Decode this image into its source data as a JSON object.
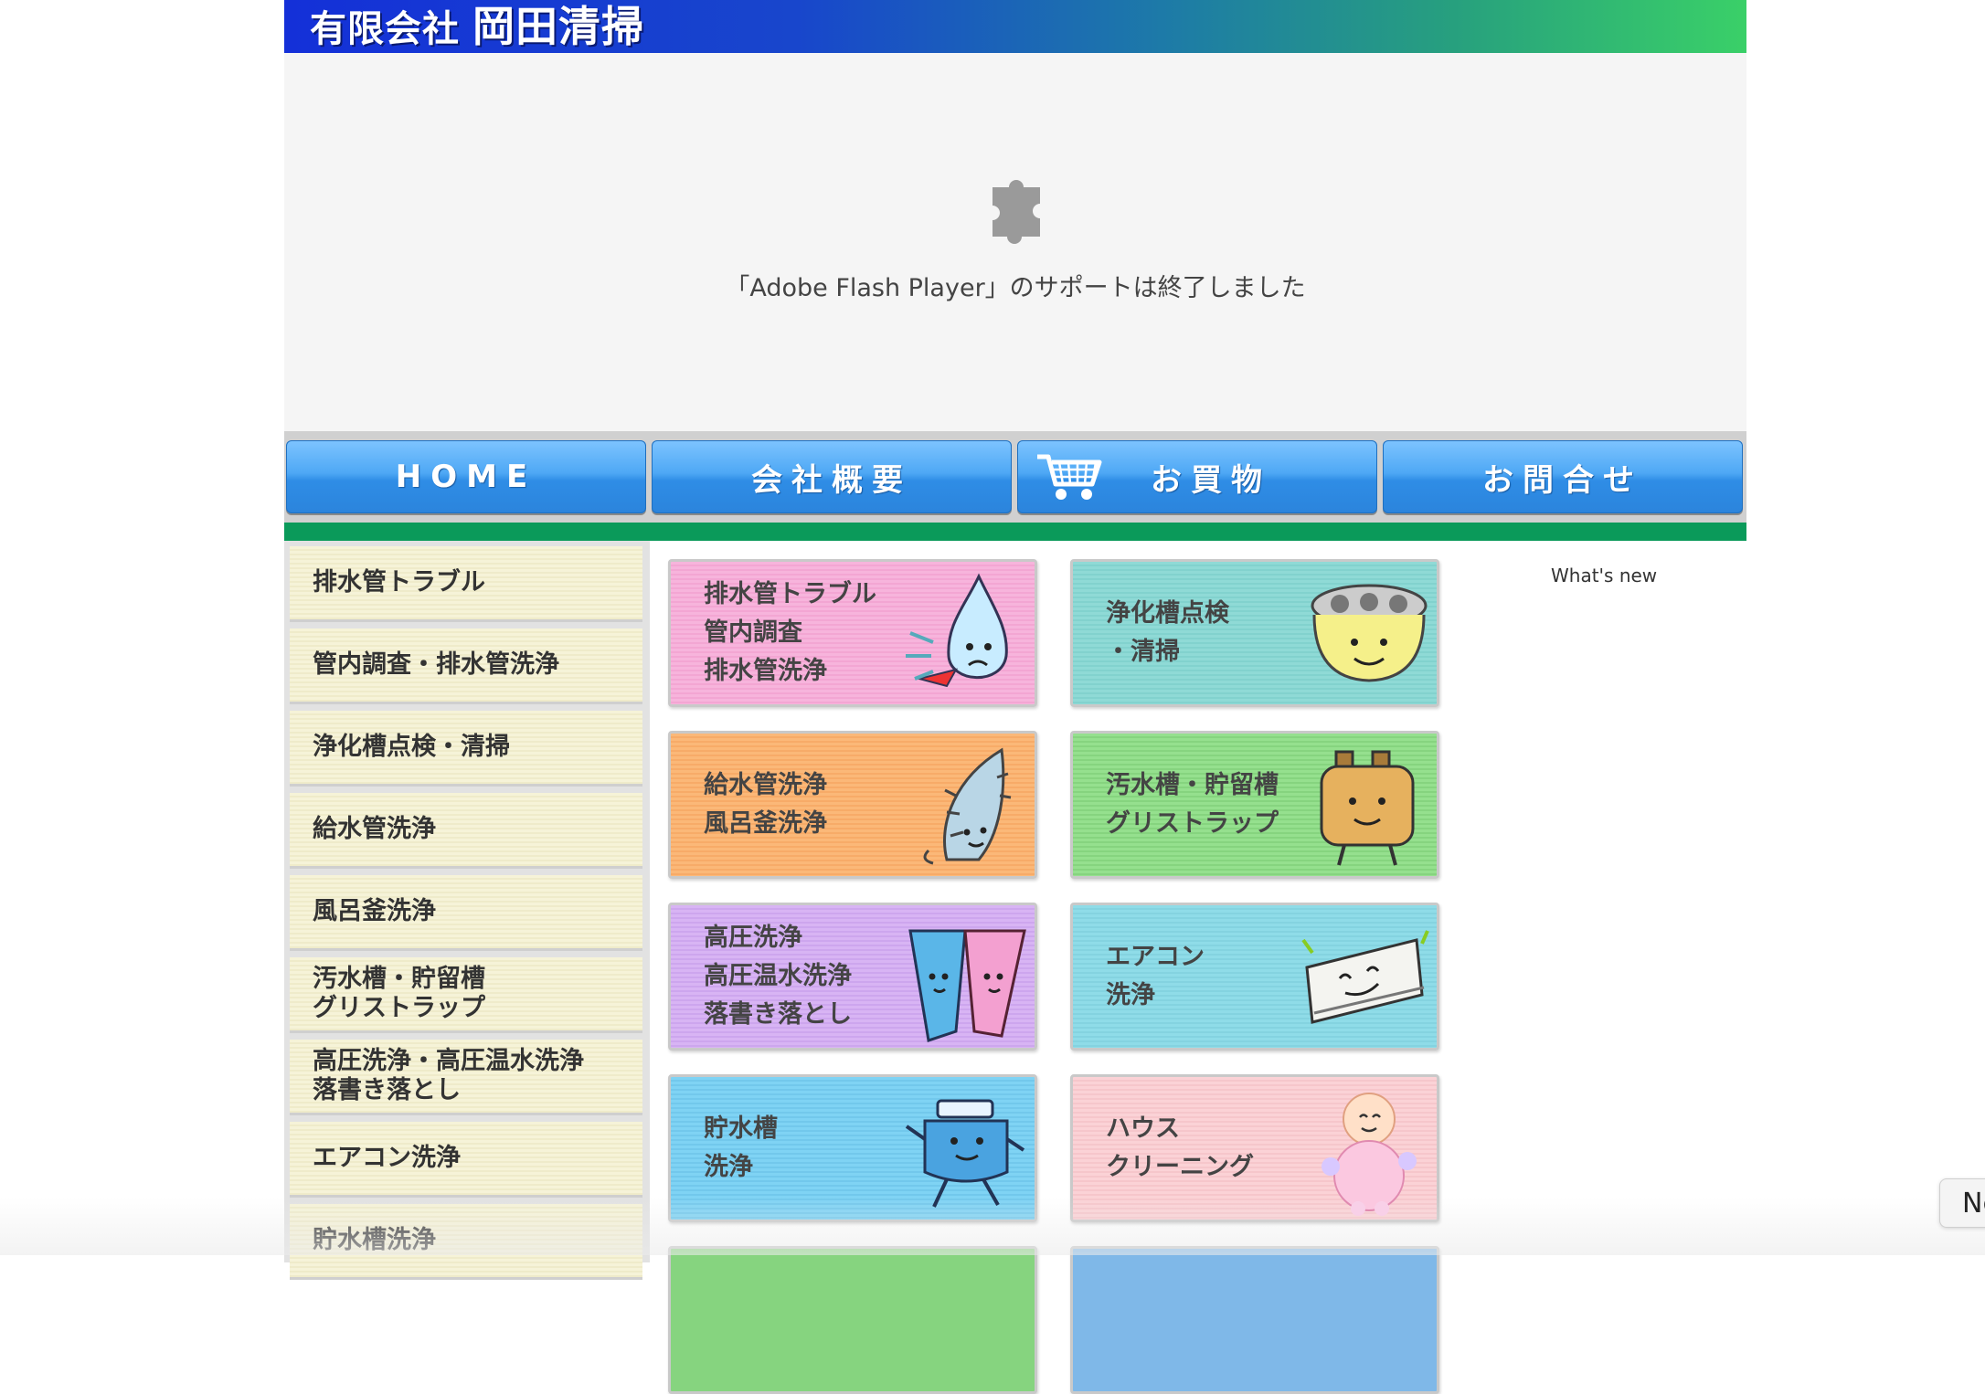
{
  "header": {
    "logo_prefix": "有限会社",
    "logo_name": "岡田清掃"
  },
  "flash": {
    "message": "「Adobe Flash Player」のサポートは終了しました",
    "icon": "puzzle-plugin-icon"
  },
  "nav": {
    "items": [
      {
        "label": "HOME"
      },
      {
        "label": "会社概要"
      },
      {
        "label": "お買物",
        "icon": "shopping-cart-icon"
      },
      {
        "label": "お問合せ"
      }
    ]
  },
  "sidebar": {
    "items": [
      {
        "label": "排水管トラブル"
      },
      {
        "label": "管内調査・排水管洗浄"
      },
      {
        "label": "浄化槽点検・清掃"
      },
      {
        "label": "給水管洗浄"
      },
      {
        "label": "風呂釜洗浄"
      },
      {
        "label": "汚水槽・貯留槽\nグリストラップ"
      },
      {
        "label": "高圧洗浄・高圧温水洗浄\n落書き落とし"
      },
      {
        "label": "エアコン洗浄"
      },
      {
        "label": "貯水槽洗浄"
      }
    ]
  },
  "tiles": [
    {
      "label": "排水管トラブル\n管内調査\n排水管洗浄",
      "color": "#f7b4dc",
      "icon": "water-drop-mascot-icon"
    },
    {
      "label": "浄化槽点検\n・清掃",
      "color": "#8fdad6",
      "icon": "septic-tank-mascot-icon"
    },
    {
      "label": "給水管洗浄\n風呂釜洗浄",
      "color": "#fbb878",
      "icon": "pipe-brush-mascot-icon"
    },
    {
      "label": "汚水槽・貯留槽\nグリストラップ",
      "color": "#95e08e",
      "icon": "tank-box-mascot-icon"
    },
    {
      "label": "高圧洗浄\n高圧温水洗浄\n落書き落とし",
      "color": "#d8b4f4",
      "icon": "water-jet-mascot-icon"
    },
    {
      "label": "エアコン\n洗浄",
      "color": "#8fdce8",
      "icon": "air-conditioner-mascot-icon"
    },
    {
      "label": "貯水槽\n洗浄",
      "color": "#7fd3f4",
      "icon": "water-tank-mascot-icon"
    },
    {
      "label": "ハウス\nクリーニング",
      "color": "#fbd2d6",
      "icon": "bubble-mascot-icon"
    }
  ],
  "whats_new": {
    "label": "What's new"
  },
  "overlay": {
    "next_label": "Ne"
  }
}
